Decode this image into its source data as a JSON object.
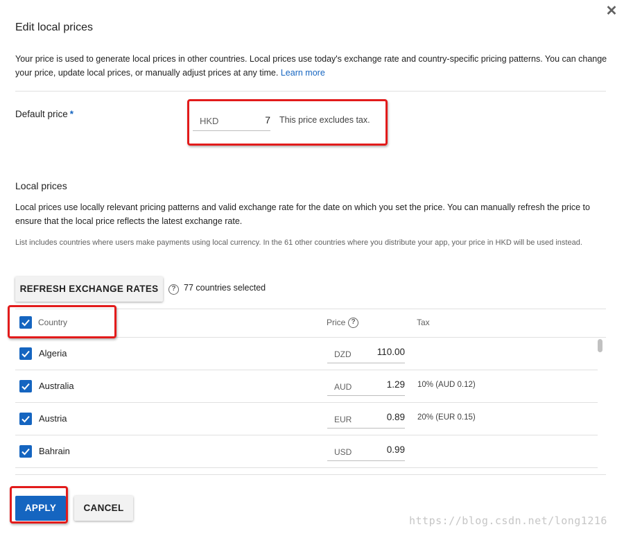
{
  "dialog": {
    "title": "Edit local prices",
    "close_icon": "close-icon",
    "intro_text": "Your price is used to generate local prices in other countries. Local prices use today's exchange rate and country-specific pricing patterns. You can change your price, update local prices, or manually adjust prices at any time.",
    "learn_more": "Learn more"
  },
  "default_price": {
    "label": "Default price",
    "required_mark": "*",
    "currency": "HKD",
    "value": "7",
    "note": "This price excludes tax."
  },
  "local_prices": {
    "heading": "Local prices",
    "description": "Local prices use locally relevant pricing patterns and valid exchange rate for the date on which you set the price. You can manually refresh the price to ensure that the local price reflects the latest exchange rate.",
    "note": "List includes countries where users make payments using local currency. In the 61 other countries where you distribute your app, your price in HKD will be used instead.",
    "refresh_button": "REFRESH EXCHANGE RATES",
    "help_icon": "help-circle-icon",
    "selected_count": "77 countries selected"
  },
  "table": {
    "headers": {
      "country": "Country",
      "price": "Price",
      "tax": "Tax"
    },
    "select_all_checked": true,
    "rows": [
      {
        "country": "Algeria",
        "currency": "DZD",
        "price": "110.00",
        "tax": "",
        "checked": true
      },
      {
        "country": "Australia",
        "currency": "AUD",
        "price": "1.29",
        "tax": "10% (AUD 0.12)",
        "checked": true
      },
      {
        "country": "Austria",
        "currency": "EUR",
        "price": "0.89",
        "tax": "20% (EUR 0.15)",
        "checked": true
      },
      {
        "country": "Bahrain",
        "currency": "USD",
        "price": "0.99",
        "tax": "",
        "checked": true
      }
    ]
  },
  "actions": {
    "apply": "APPLY",
    "cancel": "CANCEL"
  },
  "watermark": "https://blog.csdn.net/long1216",
  "colors": {
    "accent": "#1565c0",
    "annotation_red": "#e21b1b",
    "divider": "#e0e0e0"
  }
}
